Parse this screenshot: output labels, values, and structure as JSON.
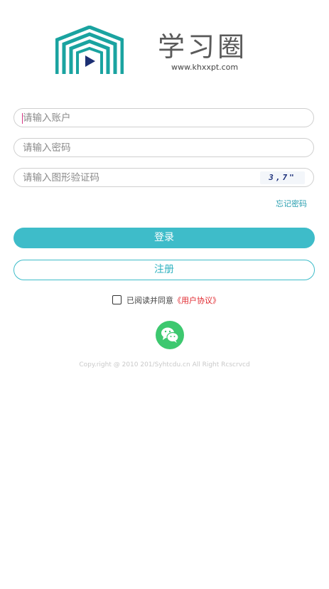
{
  "brand": {
    "title": "学习圈",
    "url": "www.khxxpt.com"
  },
  "form": {
    "account_placeholder": "请输入账户",
    "password_placeholder": "请输入密码",
    "captcha_placeholder": "请输入图形验证码",
    "captcha_text": "3,7\"",
    "forgot_label": "忘记密码",
    "login_label": "登录",
    "register_label": "注册"
  },
  "agreement": {
    "prefix": "已阅读并同意",
    "link": "《用户协议》",
    "checked": false
  },
  "social": {
    "icon": "wechat-icon"
  },
  "footer": {
    "copyright": "Copy.right @ 2010 201/Syhtcdu.cn All Right Rcscrvcd"
  },
  "colors": {
    "accent": "#3ebcc9",
    "brand_teal": "#1aa3a0",
    "play": "#1c2f73",
    "link_red": "#e0262c",
    "wechat": "#3dc86f"
  }
}
